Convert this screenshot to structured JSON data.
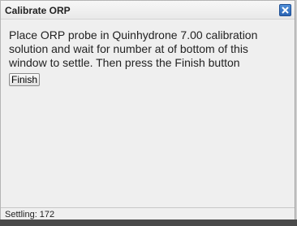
{
  "window": {
    "title": "Calibrate ORP",
    "close_icon": "close-icon",
    "accent_color": "#2a64b4"
  },
  "main": {
    "message": "Place ORP probe in Quinhydrone 7.00 calibration solution and wait for number at of bottom of this window to settle. Then press the Finish button",
    "finish_label": "Finish"
  },
  "status": {
    "text": "Settling: 172"
  }
}
